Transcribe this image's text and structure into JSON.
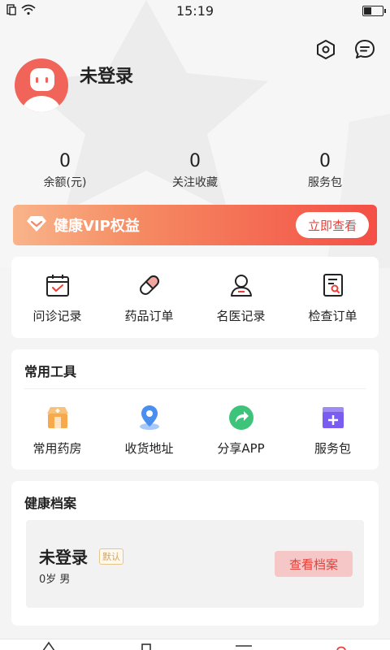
{
  "status_bar": {
    "time": "15:19",
    "battery_level": 0.45
  },
  "profile": {
    "username": "未登录"
  },
  "stats": [
    {
      "value": "0",
      "label": "余额(元)"
    },
    {
      "value": "0",
      "label": "关注收藏"
    },
    {
      "value": "0",
      "label": "服务包"
    }
  ],
  "vip": {
    "title": "健康VIP权益",
    "button": "立即查看"
  },
  "orders": [
    {
      "label": "问诊记录",
      "icon": "calendar-check-icon"
    },
    {
      "label": "药品订单",
      "icon": "pill-icon"
    },
    {
      "label": "名医记录",
      "icon": "doctor-icon"
    },
    {
      "label": "检查订单",
      "icon": "report-search-icon"
    }
  ],
  "tools": {
    "title": "常用工具",
    "items": [
      {
        "label": "常用药房",
        "icon": "pharmacy-icon",
        "color": "#f7a94b"
      },
      {
        "label": "收货地址",
        "icon": "location-pin-icon",
        "color": "#4a8ef0"
      },
      {
        "label": "分享APP",
        "icon": "share-icon",
        "color": "#3ec47a"
      },
      {
        "label": "服务包",
        "icon": "service-box-icon",
        "color": "#7b5cf0"
      }
    ]
  },
  "health": {
    "title": "健康档案",
    "name": "未登录",
    "tag": "默认",
    "sub": "0岁  男",
    "button": "查看档案"
  },
  "colors": {
    "accent": "#e8403a",
    "avatar": "#f0645a"
  }
}
